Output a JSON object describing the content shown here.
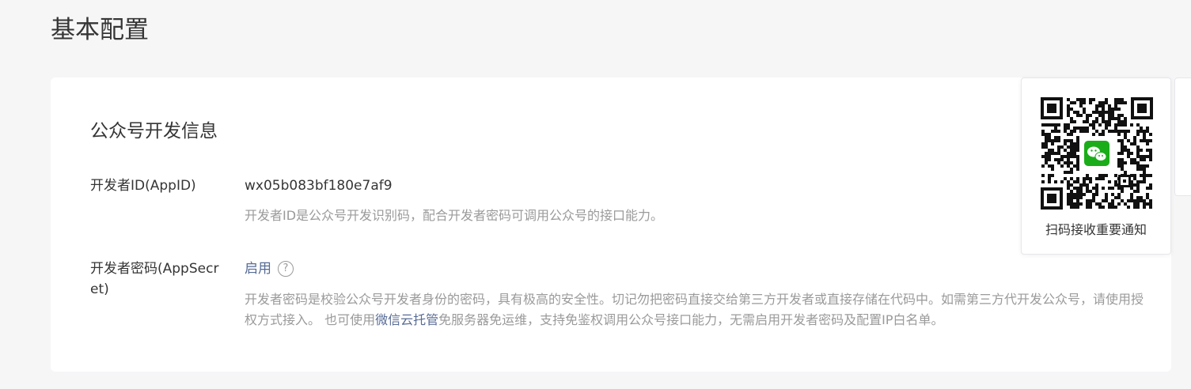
{
  "page": {
    "title": "基本配置"
  },
  "dev_info": {
    "section_title": "公众号开发信息",
    "appid": {
      "label": "开发者ID(AppID)",
      "value": "wx05b083bf180e7af9",
      "description": "开发者ID是公众号开发识别码，配合开发者密码可调用公众号的接口能力。"
    },
    "appsecret": {
      "label": "开发者密码(AppSecret)",
      "status": "启用",
      "help_icon": "question-circle-icon",
      "help_glyph": "?",
      "description_part1": "开发者密码是校验公众号开发者身份的密码，具有极高的安全性。切记勿把密码直接交给第三方开发者或直接存储在代码中。如需第三方代开发公众号，请使用授权方式接入。 也可使用",
      "link_text": "微信云托管",
      "description_part2": "免服务器免运维，支持免鉴权调用公众号接口能力，无需启用开发者密码及配置IP白名单。"
    }
  },
  "qr_panel": {
    "caption": "扫码接收重要通知",
    "icon": "wechat-icon",
    "brand_color": "#1aad19"
  },
  "colors": {
    "link": "#576b95",
    "muted": "#9a9a9a",
    "background": "#f6f6f7"
  }
}
